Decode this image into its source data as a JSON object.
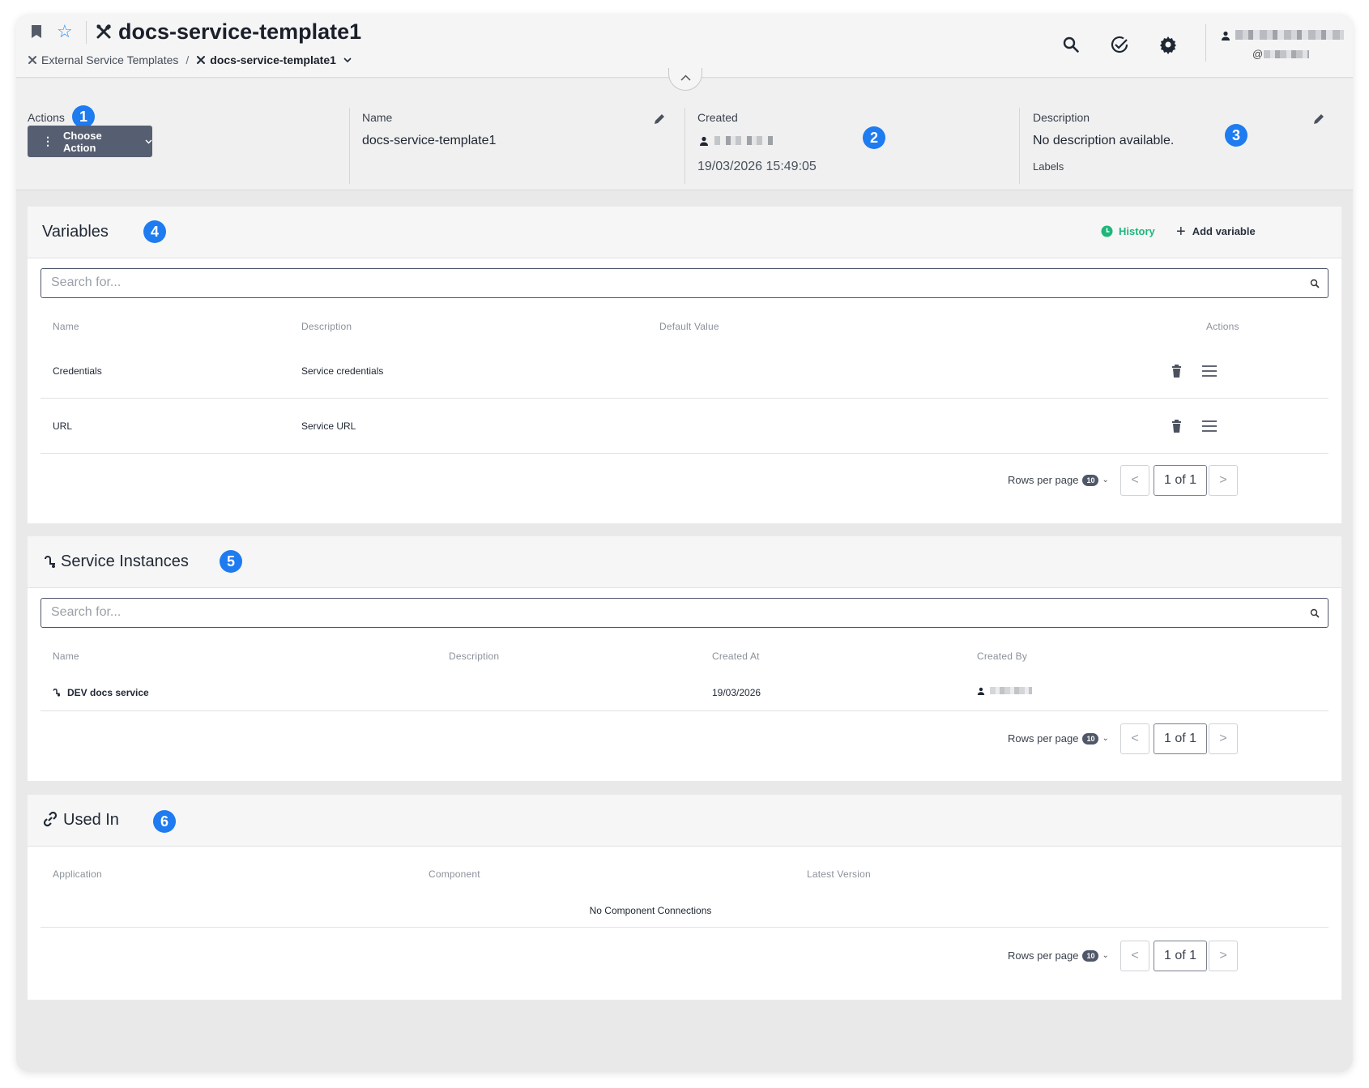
{
  "header": {
    "title": "docs-service-template1",
    "breadcrumb": {
      "parent": "External Service Templates",
      "separator": "/",
      "current": "docs-service-template1"
    },
    "user_at": "@"
  },
  "info": {
    "actions_label": "Actions",
    "choose_action": "Choose Action",
    "name_label": "Name",
    "name_value": "docs-service-template1",
    "created_label": "Created",
    "created_date": "19/03/2026 15:49:05",
    "description_label": "Description",
    "description_value": "No description available.",
    "labels_label": "Labels"
  },
  "badges": [
    "1",
    "2",
    "3",
    "4",
    "5",
    "6"
  ],
  "variables": {
    "title": "Variables",
    "history": "History",
    "add": "Add variable",
    "search_placeholder": "Search for...",
    "columns": [
      "Name",
      "Description",
      "Default Value",
      "Actions"
    ],
    "rows": [
      {
        "name": "Credentials",
        "description": "Service credentials",
        "default": ""
      },
      {
        "name": "URL",
        "description": "Service URL",
        "default": ""
      }
    ],
    "rows_per_page": "Rows per page",
    "rows_per_page_value": "10",
    "page": "1 of 1"
  },
  "instances": {
    "title": "Service Instances",
    "search_placeholder": "Search for...",
    "columns": [
      "Name",
      "Description",
      "Created At",
      "Created By"
    ],
    "rows": [
      {
        "name": "DEV docs service",
        "description": "",
        "created_at": "19/03/2026"
      }
    ],
    "rows_per_page": "Rows per page",
    "rows_per_page_value": "10",
    "page": "1 of 1"
  },
  "used_in": {
    "title": "Used In",
    "columns": [
      "Application",
      "Component",
      "Latest Version"
    ],
    "empty": "No Component Connections",
    "rows_per_page": "Rows per page",
    "rows_per_page_value": "10",
    "page": "1 of 1"
  },
  "pager": {
    "prev": "<",
    "next": ">"
  },
  "colors": {
    "accent": "#1e7bf0",
    "history": "#1db77a",
    "action_button": "#565f71"
  }
}
